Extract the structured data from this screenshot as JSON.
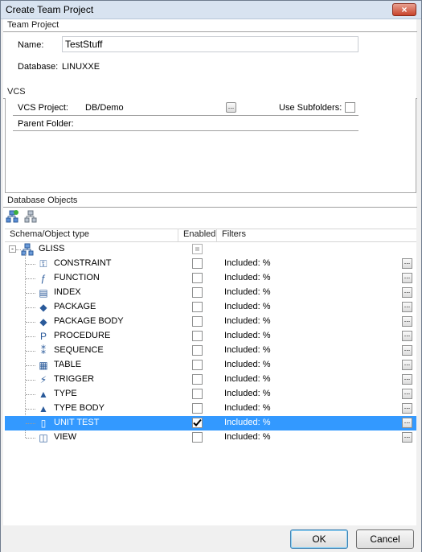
{
  "window": {
    "title": "Create Team Project",
    "close_label": "×"
  },
  "team_project": {
    "section_label": "Team Project",
    "name_label": "Name:",
    "name_value": "TestStuff",
    "database_label": "Database:",
    "database_value": "LINUXXE"
  },
  "vcs": {
    "section_label": "VCS",
    "project_label": "VCS Project:",
    "project_value": "DB/Demo",
    "browse_label": "...",
    "use_subfolders_label": "Use Subfolders:",
    "use_subfolders_checked": false,
    "parent_folder_label": "Parent Folder:",
    "parent_folder_value": ""
  },
  "db_objects": {
    "section_label": "Database Objects",
    "columns": [
      "Schema/Object type",
      "Enabled",
      "Filters"
    ],
    "schema": {
      "name": "GLISS",
      "enabled": "mixed"
    },
    "rows": [
      {
        "name": "CONSTRAINT",
        "icon": "constraint-icon",
        "glyph": "⚿",
        "enabled": false,
        "filter": "Included: %",
        "selected": false
      },
      {
        "name": "FUNCTION",
        "icon": "function-icon",
        "glyph": "ƒ",
        "enabled": false,
        "filter": "Included: %",
        "selected": false
      },
      {
        "name": "INDEX",
        "icon": "index-icon",
        "glyph": "▤",
        "enabled": false,
        "filter": "Included: %",
        "selected": false
      },
      {
        "name": "PACKAGE",
        "icon": "package-icon",
        "glyph": "◆",
        "enabled": false,
        "filter": "Included: %",
        "selected": false
      },
      {
        "name": "PACKAGE BODY",
        "icon": "package-body-icon",
        "glyph": "◆",
        "enabled": false,
        "filter": "Included: %",
        "selected": false
      },
      {
        "name": "PROCEDURE",
        "icon": "procedure-icon",
        "glyph": "P",
        "enabled": false,
        "filter": "Included: %",
        "selected": false
      },
      {
        "name": "SEQUENCE",
        "icon": "sequence-icon",
        "glyph": "⁑",
        "enabled": false,
        "filter": "Included: %",
        "selected": false
      },
      {
        "name": "TABLE",
        "icon": "table-icon",
        "glyph": "▦",
        "enabled": false,
        "filter": "Included: %",
        "selected": false
      },
      {
        "name": "TRIGGER",
        "icon": "trigger-icon",
        "glyph": "⚡",
        "enabled": false,
        "filter": "Included: %",
        "selected": false
      },
      {
        "name": "TYPE",
        "icon": "type-icon",
        "glyph": "▲",
        "enabled": false,
        "filter": "Included: %",
        "selected": false
      },
      {
        "name": "TYPE BODY",
        "icon": "type-body-icon",
        "glyph": "▲",
        "enabled": false,
        "filter": "Included: %",
        "selected": false
      },
      {
        "name": "UNIT TEST",
        "icon": "unit-test-icon",
        "glyph": "▯",
        "enabled": true,
        "filter": "Included: %",
        "selected": true
      },
      {
        "name": "VIEW",
        "icon": "view-icon",
        "glyph": "◫",
        "enabled": false,
        "filter": "Included: %",
        "selected": false
      }
    ],
    "dots_label": "..."
  },
  "footer": {
    "ok_label": "OK",
    "cancel_label": "Cancel"
  }
}
